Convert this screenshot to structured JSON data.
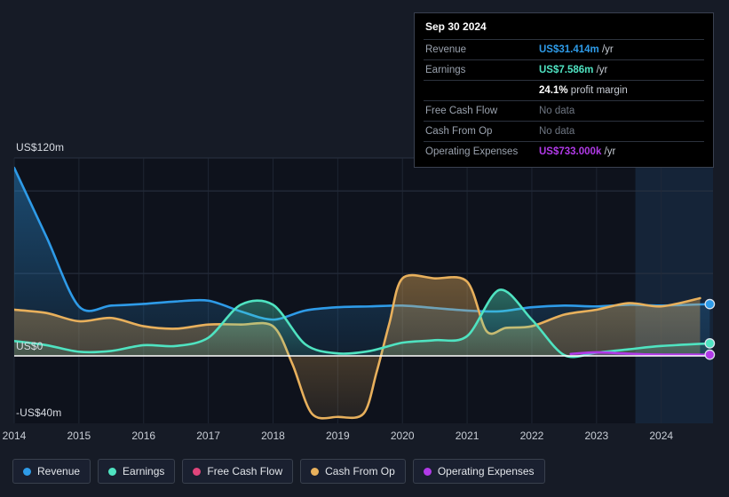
{
  "chart_data": {
    "type": "area",
    "title": "",
    "xlabel": "",
    "ylabel": "",
    "x_ticks": [
      "2014",
      "2015",
      "2016",
      "2017",
      "2018",
      "2019",
      "2020",
      "2021",
      "2022",
      "2023",
      "2024"
    ],
    "y_ticks": [
      "US$120m",
      "US$0",
      "-US$40m"
    ],
    "ylim": [
      -40,
      120
    ],
    "xlim": [
      2014,
      2024.8
    ],
    "grid": true,
    "legend_position": "bottom",
    "currency": "USD",
    "units": "millions",
    "series": [
      {
        "name": "Revenue",
        "color": "#2E9BE8",
        "x": [
          2014,
          2014.5,
          2015,
          2015.5,
          2016,
          2016.5,
          2017,
          2017.5,
          2018,
          2018.5,
          2019,
          2019.5,
          2020,
          2020.5,
          2021,
          2021.5,
          2022,
          2022.5,
          2023,
          2023.5,
          2024,
          2024.75
        ],
        "values": [
          114,
          72,
          30,
          30.5,
          31.5,
          33,
          33.5,
          27,
          22,
          27.5,
          29.5,
          30,
          30.5,
          29,
          27.5,
          27,
          29.5,
          30.5,
          30,
          31,
          30.5,
          31.414
        ]
      },
      {
        "name": "Earnings",
        "color": "#4FE3C1",
        "x": [
          2014,
          2014.5,
          2015,
          2015.5,
          2016,
          2016.5,
          2017,
          2017.5,
          2018,
          2018.5,
          2019,
          2019.5,
          2020,
          2020.5,
          2021,
          2021.5,
          2022,
          2022.5,
          2023,
          2023.5,
          2024,
          2024.75
        ],
        "values": [
          9,
          6.5,
          2.5,
          3,
          6.5,
          6,
          11,
          31,
          31,
          7,
          1.5,
          3,
          8,
          9.5,
          12,
          40,
          22,
          0.5,
          2,
          4,
          6,
          7.586
        ]
      },
      {
        "name": "Free Cash Flow",
        "color": "#E0457B",
        "x": [],
        "values": []
      },
      {
        "name": "Cash From Op",
        "color": "#E8B05C",
        "x": [
          2014,
          2014.5,
          2015,
          2015.5,
          2016,
          2016.5,
          2017,
          2017.5,
          2018,
          2018.3,
          2018.6,
          2019,
          2019.4,
          2019.6,
          2019.8,
          2020,
          2020.5,
          2021,
          2021.3,
          2021.6,
          2022,
          2022.5,
          2023,
          2023.5,
          2024,
          2024.6
        ],
        "values": [
          28,
          26,
          21,
          23,
          18,
          16.5,
          19,
          19,
          18,
          -5,
          -35,
          -37,
          -35,
          -10,
          20,
          47,
          47,
          45,
          15,
          17,
          18,
          25,
          28,
          32,
          30,
          35
        ]
      },
      {
        "name": "Operating Expenses",
        "color": "#B13AE8",
        "x": [
          2022.6,
          2023,
          2023.4,
          2023.8,
          2024.2,
          2024.75
        ],
        "values": [
          1.2,
          2.2,
          1.5,
          0.9,
          0.8,
          0.733
        ]
      }
    ],
    "forecast_region": {
      "start": 2023.6,
      "end": 2024.8
    }
  },
  "tooltip": {
    "date": "Sep 30 2024",
    "rows": [
      {
        "key": "Revenue",
        "value": "US$31.414m",
        "unit": " /yr",
        "color": "#2E9BE8",
        "no_data": false
      },
      {
        "key": "Earnings",
        "value": "US$7.586m",
        "unit": " /yr",
        "color": "#4FE3C1",
        "no_data": false
      },
      {
        "key": "",
        "value": "24.1%",
        "unit": " profit margin",
        "color": "#FFFFFF",
        "no_data": false
      },
      {
        "key": "Free Cash Flow",
        "value": "No data",
        "unit": "",
        "color": "#6E7682",
        "no_data": true
      },
      {
        "key": "Cash From Op",
        "value": "No data",
        "unit": "",
        "color": "#6E7682",
        "no_data": true
      },
      {
        "key": "Operating Expenses",
        "value": "US$733.000k",
        "unit": " /yr",
        "color": "#B13AE8",
        "no_data": false
      }
    ]
  },
  "legend": {
    "items": [
      {
        "label": "Revenue",
        "color": "#2E9BE8"
      },
      {
        "label": "Earnings",
        "color": "#4FE3C1"
      },
      {
        "label": "Free Cash Flow",
        "color": "#E0457B"
      },
      {
        "label": "Cash From Op",
        "color": "#E8B05C"
      },
      {
        "label": "Operating Expenses",
        "color": "#B13AE8"
      }
    ]
  },
  "axes": {
    "y_top": "US$120m",
    "y_zero": "US$0",
    "y_neg": "-US$40m"
  }
}
